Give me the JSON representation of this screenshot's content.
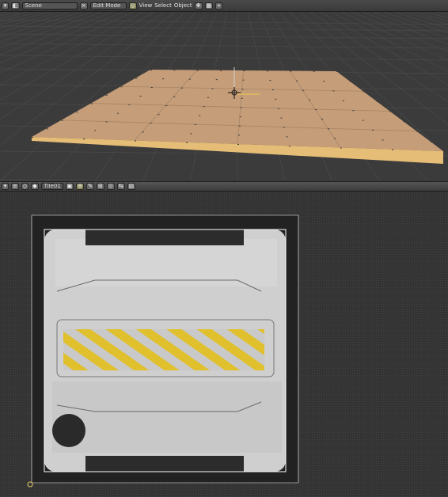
{
  "header": {
    "scene_field": "Scene",
    "mode_select": "Edit Mode",
    "view_label": "View",
    "select_label": "Select",
    "object_label": "Object"
  },
  "uv_header": {
    "image_field": "Tile01"
  },
  "icons": [
    "editor-type-icon",
    "screen-browse-icon",
    "scene-browse-icon",
    "mode-icon",
    "pivot-icon",
    "manipulator-icon",
    "layer-icon",
    "snap-icon",
    "uv-select-icon",
    "sticky-icon",
    "image-browse-icon",
    "pin-icon",
    "paint-icon",
    "lock-icon"
  ],
  "colors": {
    "floor_top": "#c9a07a",
    "floor_side": "#e8c07a",
    "grid": "#505050",
    "uv_edge": "#ffffff",
    "hazard_stripe": "#e2c12a",
    "metal": "#d8d8d8",
    "panel_dark": "#2a2a2a"
  }
}
